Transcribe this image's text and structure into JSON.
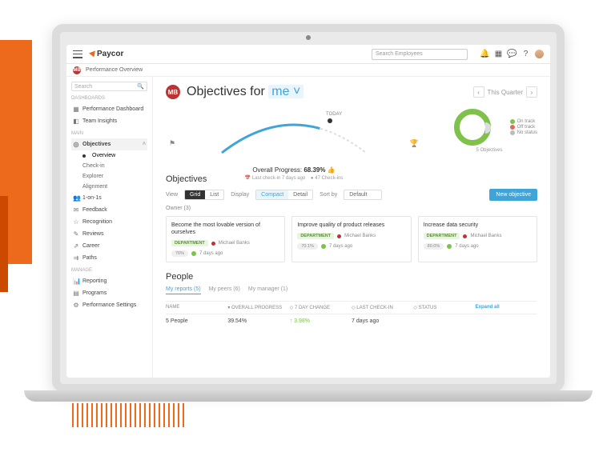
{
  "brand": "Paycor",
  "breadcrumb": "Performance Overview",
  "search_placeholder": "Search Employees",
  "sidebar": {
    "search": "Search",
    "heads": {
      "dash": "DASHBOARDS",
      "main": "MAIN",
      "manage": "MANAGE"
    },
    "dash": [
      {
        "label": "Performance Dashboard"
      },
      {
        "label": "Team Insights"
      }
    ],
    "main": [
      {
        "label": "Objectives",
        "selected": true,
        "expand": true
      },
      {
        "label": "Overview",
        "sub": true,
        "active": true
      },
      {
        "label": "Check-in",
        "sub": true
      },
      {
        "label": "Explorer",
        "sub": true
      },
      {
        "label": "Alignment",
        "sub": true
      },
      {
        "label": "1-on-1s"
      },
      {
        "label": "Feedback"
      },
      {
        "label": "Recognition"
      },
      {
        "label": "Reviews"
      },
      {
        "label": "Career"
      },
      {
        "label": "Paths"
      }
    ],
    "manage": [
      {
        "label": "Reporting"
      },
      {
        "label": "Programs"
      },
      {
        "label": "Performance Settings"
      }
    ]
  },
  "header": {
    "initials": "MB",
    "title_prefix": "Objectives for",
    "title_target": "me",
    "period": "This Quarter"
  },
  "progress": {
    "label": "Overall Progress:",
    "value": "68.39%",
    "meta_left": "Last check-in 7 days ago",
    "meta_right": "47 Check-ins",
    "today": "TODAY"
  },
  "donut": {
    "count": "5 Objectives",
    "legend": [
      {
        "label": "On track",
        "color": "#7fc24b"
      },
      {
        "label": "Off track",
        "color": "#e06a5a"
      },
      {
        "label": "No status",
        "color": "#bbb"
      }
    ]
  },
  "objectives": {
    "heading": "Objectives",
    "view_label": "View",
    "view_grid": "Grid",
    "view_list": "List",
    "display_label": "Display",
    "display_compact": "Compact",
    "display_detail": "Detail",
    "sort_label": "Sort by",
    "sort_value": "Default",
    "new_btn": "New objective",
    "owner": "Owner (3)",
    "cards": [
      {
        "title": "Become the most lovable version of ourselves",
        "dept": "DEPARTMENT",
        "person": "Michael Banks",
        "pill": "76%",
        "when": "7 days ago"
      },
      {
        "title": "Improve quality of product releases",
        "dept": "DEPARTMENT",
        "person": "Michael Banks",
        "pill": "70.1%",
        "when": "7 days ago"
      },
      {
        "title": "Increase data security",
        "dept": "DEPARTMENT",
        "person": "Michael Banks",
        "pill": "80.0%",
        "when": "7 days ago"
      }
    ]
  },
  "people": {
    "heading": "People",
    "tabs": [
      {
        "label": "My reports (5)",
        "active": true
      },
      {
        "label": "My peers (6)"
      },
      {
        "label": "My manager (1)"
      }
    ],
    "cols": {
      "name": "NAME",
      "prog": "OVERALL PROGRESS",
      "chg": "7 DAY CHANGE",
      "last": "LAST CHECK-IN",
      "status": "STATUS",
      "expand": "Expand all"
    },
    "row": {
      "name": "5 People",
      "prog": "39.54%",
      "chg": "↑ 3.98%",
      "last": "7 days ago"
    }
  }
}
